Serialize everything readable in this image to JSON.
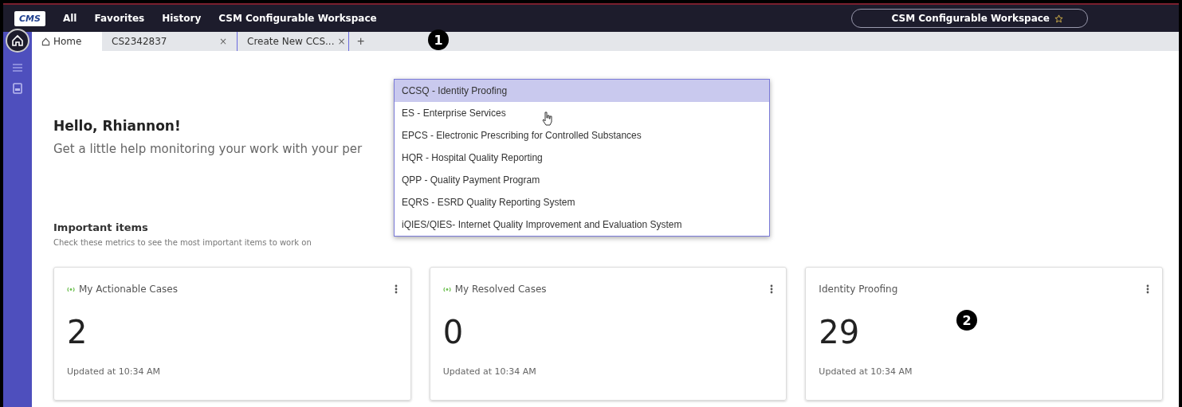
{
  "top_nav": {
    "logo": "CMS",
    "items": [
      "All",
      "Favorites",
      "History",
      "CSM Configurable Workspace"
    ],
    "workspace_button": "CSM Configurable Workspace"
  },
  "tabs": [
    {
      "label": "Home",
      "selected": true
    },
    {
      "label": "CS2342837",
      "selected": false,
      "close": "×"
    },
    {
      "label": "Create New CCS...",
      "selected": false,
      "close": "×"
    }
  ],
  "add_tab": "+",
  "callouts": [
    "1",
    "2"
  ],
  "greeting": {
    "title": "Hello, Rhiannon!",
    "subtitle": "Get a little help monitoring your work with your per"
  },
  "important": {
    "title": "Important items",
    "subtitle": "Check these metrics to see the most important items to work on"
  },
  "cards": [
    {
      "title": "My Actionable Cases",
      "live_indicator": true,
      "value": "2",
      "updated": "Updated at 10:34 AM"
    },
    {
      "title": "My Resolved Cases",
      "live_indicator": true,
      "value": "0",
      "updated": "Updated at 10:34 AM"
    },
    {
      "title": "Identity Proofing",
      "live_indicator": false,
      "value": "29",
      "updated": "Updated at 10:34 AM"
    }
  ],
  "dropdown": [
    {
      "label": "CCSQ - Identity Proofing",
      "selected": true
    },
    {
      "label": "ES - Enterprise Services",
      "selected": false
    },
    {
      "label": "EPCS - Electronic Prescribing for Controlled Substances",
      "selected": false
    },
    {
      "label": "HQR - Hospital Quality Reporting",
      "selected": false
    },
    {
      "label": "QPP - Quality Payment Program",
      "selected": false
    },
    {
      "label": "EQRS - ESRD Quality Reporting System",
      "selected": false
    },
    {
      "label": "iQIES/QIES- Internet Quality Improvement and Evaluation System",
      "selected": false
    }
  ]
}
